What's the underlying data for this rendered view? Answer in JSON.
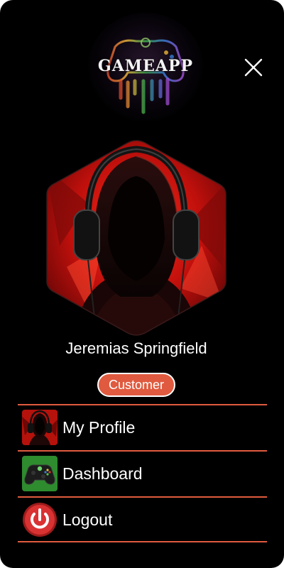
{
  "app": {
    "logo_text": "GAMEAPP",
    "close_icon": "close-icon"
  },
  "user": {
    "name": "Jeremias Springfield",
    "role": "Customer",
    "avatar": "hooded-gamer-headphones-avatar"
  },
  "menu": {
    "items": [
      {
        "label": "My Profile",
        "icon": "profile-avatar-icon"
      },
      {
        "label": "Dashboard",
        "icon": "gamepad-icon"
      },
      {
        "label": "Logout",
        "icon": "power-icon"
      }
    ]
  },
  "colors": {
    "background": "#000000",
    "accent": "#e05a3f",
    "text": "#ffffff",
    "dashboard_icon_bg": "#2e8b2e",
    "logout_icon": "#d32f2f"
  }
}
